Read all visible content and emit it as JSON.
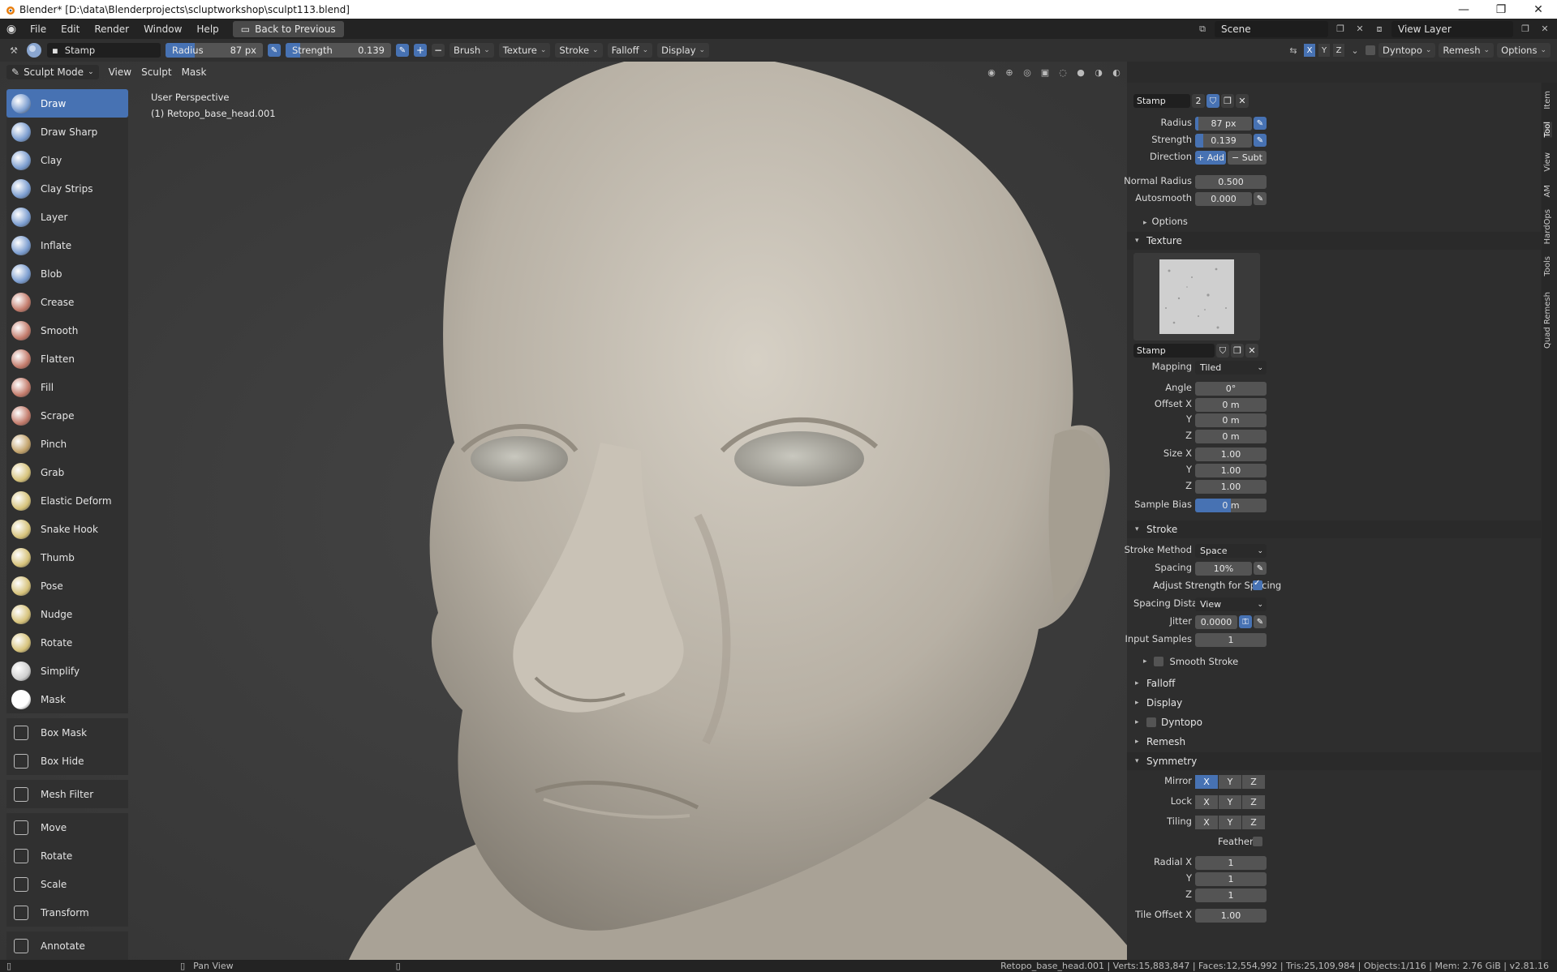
{
  "window": {
    "title": "Blender* [D:\\data\\Blenderprojects\\scluptworkshop\\sculpt113.blend]",
    "minimize": "—",
    "maximize": "❐",
    "close": "✕"
  },
  "menu": {
    "items": [
      "File",
      "Edit",
      "Render",
      "Window",
      "Help"
    ],
    "back_button": "Back to Previous",
    "scene": "Scene",
    "view_layer": "View Layer"
  },
  "tool_header": {
    "brush_name": "Stamp",
    "radius_label": "Radius",
    "radius_value": "87 px",
    "strength_label": "Strength",
    "strength_value": "0.139",
    "strength_fraction": 0.139,
    "menus": [
      "Brush",
      "Texture",
      "Stroke",
      "Falloff",
      "Display"
    ],
    "axes": [
      "X",
      "Y",
      "Z"
    ],
    "dyntopo": "Dyntopo",
    "remesh": "Remesh",
    "options": "Options"
  },
  "mode_header": {
    "mode": "Sculpt Mode",
    "items": [
      "View",
      "Sculpt",
      "Mask"
    ]
  },
  "viewport": {
    "perspective": "User Perspective",
    "object": "(1) Retopo_base_head.001"
  },
  "toolbar": {
    "tools": [
      {
        "label": "Draw",
        "icon": "draw-brush-icon",
        "color": "#7a9ccf",
        "active": true
      },
      {
        "label": "Draw Sharp",
        "icon": "draw-sharp-brush-icon",
        "color": "#7a9ccf"
      },
      {
        "label": "Clay",
        "icon": "clay-brush-icon",
        "color": "#7a9ccf"
      },
      {
        "label": "Clay Strips",
        "icon": "clay-strips-brush-icon",
        "color": "#7a9ccf"
      },
      {
        "label": "Layer",
        "icon": "layer-brush-icon",
        "color": "#7a9ccf"
      },
      {
        "label": "Inflate",
        "icon": "inflate-brush-icon",
        "color": "#7a9ccf"
      },
      {
        "label": "Blob",
        "icon": "blob-brush-icon",
        "color": "#7a9ccf"
      },
      {
        "label": "Crease",
        "icon": "crease-brush-icon",
        "color": "#c27a6a"
      },
      {
        "label": "Smooth",
        "icon": "smooth-brush-icon",
        "color": "#c27a6a"
      },
      {
        "label": "Flatten",
        "icon": "flatten-brush-icon",
        "color": "#c27a6a"
      },
      {
        "label": "Fill",
        "icon": "fill-brush-icon",
        "color": "#c27a6a"
      },
      {
        "label": "Scrape",
        "icon": "scrape-brush-icon",
        "color": "#c27a6a"
      },
      {
        "label": "Pinch",
        "icon": "pinch-brush-icon",
        "color": "#c2a26a"
      },
      {
        "label": "Grab",
        "icon": "grab-brush-icon",
        "color": "#d6c27a"
      },
      {
        "label": "Elastic Deform",
        "icon": "elastic-deform-brush-icon",
        "color": "#d6c27a"
      },
      {
        "label": "Snake Hook",
        "icon": "snake-hook-brush-icon",
        "color": "#d6c27a"
      },
      {
        "label": "Thumb",
        "icon": "thumb-brush-icon",
        "color": "#d6c27a"
      },
      {
        "label": "Pose",
        "icon": "pose-brush-icon",
        "color": "#d6c27a"
      },
      {
        "label": "Nudge",
        "icon": "nudge-brush-icon",
        "color": "#d6c27a"
      },
      {
        "label": "Rotate",
        "icon": "rotate-brush-icon",
        "color": "#d6c27a"
      },
      {
        "label": "Simplify",
        "icon": "simplify-brush-icon",
        "color": "#cfcfcf"
      },
      {
        "label": "Mask",
        "icon": "mask-brush-icon",
        "color": "#ffffff"
      }
    ],
    "group2": [
      {
        "label": "Box Mask",
        "icon": "box-mask-icon"
      },
      {
        "label": "Box Hide",
        "icon": "box-hide-icon"
      }
    ],
    "group3": [
      {
        "label": "Mesh Filter",
        "icon": "mesh-filter-icon"
      }
    ],
    "group4": [
      {
        "label": "Move",
        "icon": "move-icon"
      },
      {
        "label": "Rotate",
        "icon": "rotate-icon"
      },
      {
        "label": "Scale",
        "icon": "scale-icon"
      },
      {
        "label": "Transform",
        "icon": "transform-icon"
      }
    ],
    "group5": [
      {
        "label": "Annotate",
        "icon": "annotate-icon"
      }
    ]
  },
  "sidebar": {
    "brush_name": "Stamp",
    "brush_users": "2",
    "radius_label": "Radius",
    "radius": "87 px",
    "strength_label": "Strength",
    "strength": "0.139",
    "direction_label": "Direction",
    "add": "+ Add",
    "subtract": "− Subt",
    "normal_radius_label": "Normal Radius",
    "normal_radius": "0.500",
    "autosmooth_label": "Autosmooth",
    "autosmooth": "0.000",
    "options": "Options",
    "texture": {
      "header": "Texture",
      "name": "Stamp",
      "mapping_label": "Mapping",
      "mapping": "Tiled",
      "angle_label": "Angle",
      "angle": "0°",
      "offset_x_label": "Offset X",
      "offset_x": "0 m",
      "y_label": "Y",
      "offset_y": "0 m",
      "z_label": "Z",
      "offset_z": "0 m",
      "size_x_label": "Size X",
      "size_x": "1.00",
      "size_y": "1.00",
      "size_z": "1.00",
      "sample_bias_label": "Sample Bias",
      "sample_bias": "0 m"
    },
    "stroke": {
      "header": "Stroke",
      "method_label": "Stroke Method",
      "method": "Space",
      "spacing_label": "Spacing",
      "spacing": "10%",
      "adjust_label": "Adjust Strength for Spacing",
      "spacing_distance_label": "Spacing Distanc",
      "spacing_distance": "View",
      "jitter_label": "Jitter",
      "jitter": "0.0000",
      "input_samples_label": "Input Samples",
      "input_samples": "1",
      "smooth_stroke": "Smooth Stroke"
    },
    "collapsed": [
      "Falloff",
      "Display",
      "Dyntopo",
      "Remesh"
    ],
    "symmetry": {
      "header": "Symmetry",
      "mirror_label": "Mirror",
      "lock_label": "Lock",
      "tiling_label": "Tiling",
      "feather_label": "Feather",
      "radial_x_label": "Radial X",
      "radial_x": "1",
      "radial_y_label": "Y",
      "radial_y": "1",
      "radial_z_label": "Z",
      "radial_z": "1",
      "tile_offset_label": "Tile Offset X",
      "tile_offset": "1.00"
    },
    "tabs": [
      "Item",
      "Tool",
      "View",
      "AM",
      "HardOps",
      "Tools",
      "Quad Remesh"
    ]
  },
  "status": {
    "pan": "Pan View",
    "stats": "Retopo_base_head.001 | Verts:15,883,847 | Faces:12,554,992 | Tris:25,109,984 | Objects:1/116 | Mem: 2.76 GiB | v2.81.16"
  }
}
